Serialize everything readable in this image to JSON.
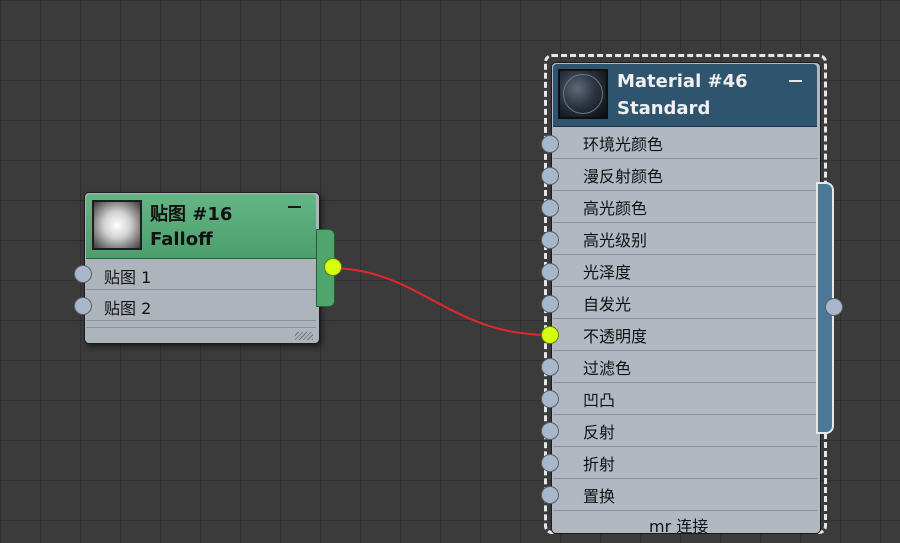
{
  "falloff_node": {
    "title": "贴图 #16",
    "subtitle": "Falloff",
    "inputs": [
      {
        "label": "贴图 1"
      },
      {
        "label": "贴图 2"
      }
    ]
  },
  "material_node": {
    "title": "Material #46",
    "subtitle": "Standard",
    "slots": [
      {
        "label": "环境光颜色"
      },
      {
        "label": "漫反射颜色"
      },
      {
        "label": "高光颜色"
      },
      {
        "label": "高光级别"
      },
      {
        "label": "光泽度"
      },
      {
        "label": "自发光"
      },
      {
        "label": "不透明度"
      },
      {
        "label": "过滤色"
      },
      {
        "label": "凹凸"
      },
      {
        "label": "反射"
      },
      {
        "label": "折射"
      },
      {
        "label": "置换"
      },
      {
        "label": "mr 连接"
      }
    ]
  },
  "colors": {
    "canvas": "#3b3b3b",
    "map_header": "#5aae79",
    "material_header": "#2e546e",
    "node_body": "#b1b8c2",
    "socket": "#a9b7cb",
    "socket_active": "#d5ff0f",
    "wire": "#e0272d"
  },
  "connection": {
    "from": "falloff_node.output",
    "to": "material_node.slots.6"
  }
}
